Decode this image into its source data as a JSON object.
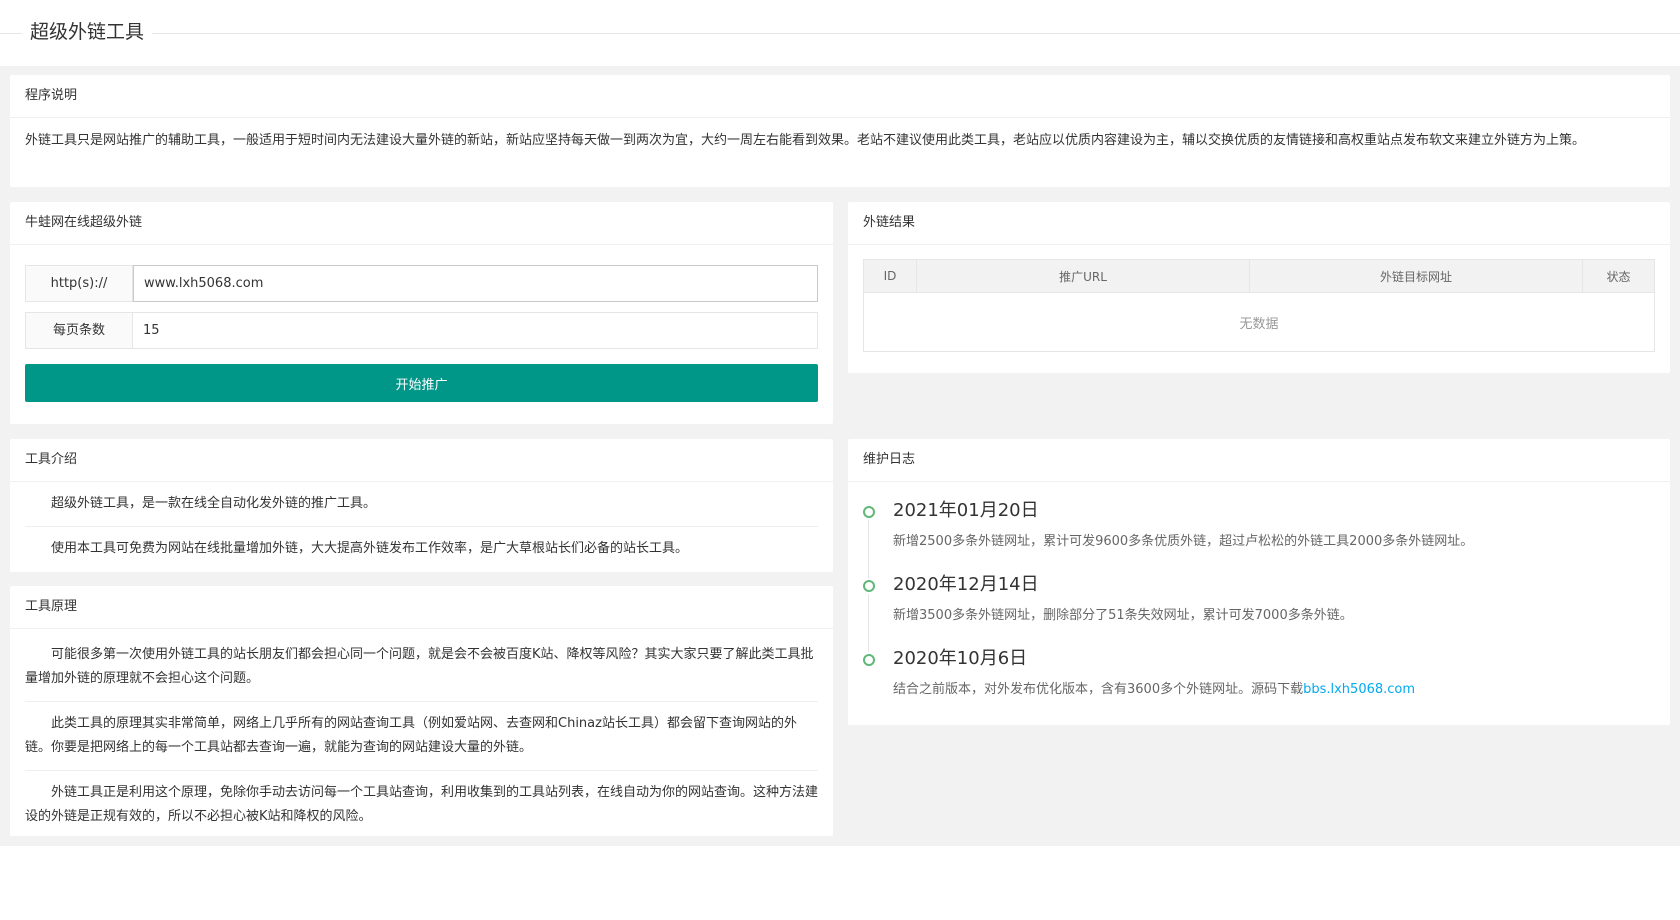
{
  "header": {
    "title": "超级外链工具"
  },
  "intro": {
    "title": "程序说明",
    "text": "外链工具只是网站推广的辅助工具，一般适用于短时间内无法建设大量外链的新站，新站应坚持每天做一到两次为宜，大约一周左右能看到效果。老站不建议使用此类工具，老站应以优质内容建设为主，辅以交换优质的友情链接和高权重站点发布软文来建立外链方为上策。"
  },
  "form": {
    "title": "牛蛙网在线超级外链",
    "url_label": "http(s)://",
    "url_value": "www.lxh5068.com",
    "per_page_label": "每页条数",
    "per_page_value": "15",
    "submit_label": "开始推广"
  },
  "result": {
    "title": "外链结果",
    "columns": [
      "ID",
      "推广URL",
      "外链目标网址",
      "状态"
    ],
    "empty_text": "无数据"
  },
  "tool_intro": {
    "title": "工具介绍",
    "paragraphs": [
      "超级外链工具，是一款在线全自动化发外链的推广工具。",
      "使用本工具可免费为网站在线批量增加外链，大大提高外链发布工作效率，是广大草根站长们必备的站长工具。"
    ]
  },
  "principle": {
    "title": "工具原理",
    "paragraphs": [
      "可能很多第一次使用外链工具的站长朋友们都会担心同一个问题，就是会不会被百度K站、降权等风险？其实大家只要了解此类工具批量增加外链的原理就不会担心这个问题。",
      "此类工具的原理其实非常简单，网络上几乎所有的网站查询工具（例如爱站网、去查网和Chinaz站长工具）都会留下查询网站的外链。你要是把网络上的每一个工具站都去查询一遍，就能为查询的网站建设大量的外链。",
      "外链工具正是利用这个原理，免除你手动去访问每一个工具站查询，利用收集到的工具站列表，在线自动为你的网站查询。这种方法建设的外链是正规有效的，所以不必担心被K站和降权的风险。"
    ]
  },
  "log": {
    "title": "维护日志",
    "items": [
      {
        "date": "2021年01月20日",
        "text": "新增2500多条外链网址，累计可发9600多条优质外链，超过卢松松的外链工具2000多条外链网址。"
      },
      {
        "date": "2020年12月14日",
        "text": "新增3500多条外链网址，删除部分了51条失效网址，累计可发7000多条外链。"
      },
      {
        "date": "2020年10月6日",
        "text": "结合之前版本，对外发布优化版本，含有3600多个外链网址。源码下载",
        "link": "bbs.lxh5068.com"
      }
    ]
  },
  "colors": {
    "accent": "#009688",
    "timeline": "#5FB878",
    "link": "#01AAED",
    "bg": "#f2f2f2"
  }
}
